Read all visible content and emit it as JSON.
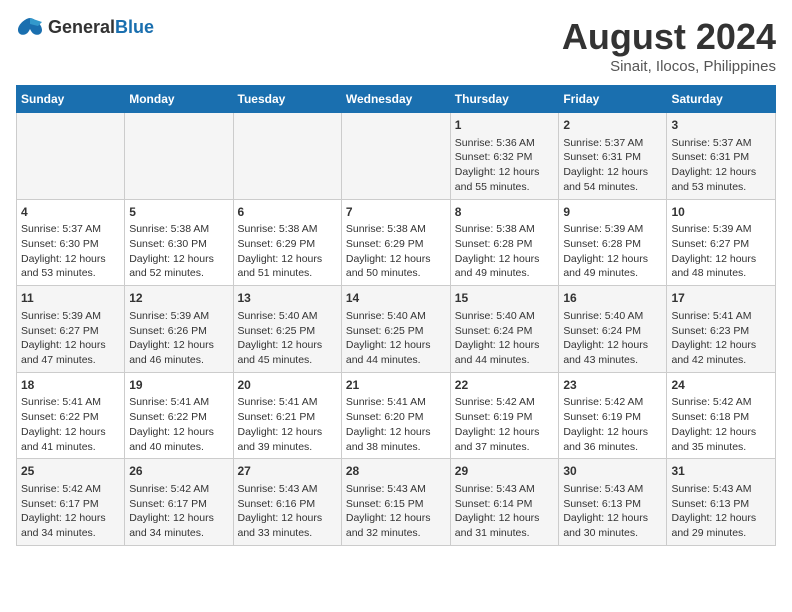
{
  "logo": {
    "general": "General",
    "blue": "Blue"
  },
  "title": "August 2024",
  "subtitle": "Sinait, Ilocos, Philippines",
  "days_of_week": [
    "Sunday",
    "Monday",
    "Tuesday",
    "Wednesday",
    "Thursday",
    "Friday",
    "Saturday"
  ],
  "weeks": [
    [
      {
        "day": "",
        "sunrise": "",
        "sunset": "",
        "daylight": ""
      },
      {
        "day": "",
        "sunrise": "",
        "sunset": "",
        "daylight": ""
      },
      {
        "day": "",
        "sunrise": "",
        "sunset": "",
        "daylight": ""
      },
      {
        "day": "",
        "sunrise": "",
        "sunset": "",
        "daylight": ""
      },
      {
        "day": "1",
        "sunrise": "Sunrise: 5:36 AM",
        "sunset": "Sunset: 6:32 PM",
        "daylight": "Daylight: 12 hours and 55 minutes."
      },
      {
        "day": "2",
        "sunrise": "Sunrise: 5:37 AM",
        "sunset": "Sunset: 6:31 PM",
        "daylight": "Daylight: 12 hours and 54 minutes."
      },
      {
        "day": "3",
        "sunrise": "Sunrise: 5:37 AM",
        "sunset": "Sunset: 6:31 PM",
        "daylight": "Daylight: 12 hours and 53 minutes."
      }
    ],
    [
      {
        "day": "4",
        "sunrise": "Sunrise: 5:37 AM",
        "sunset": "Sunset: 6:30 PM",
        "daylight": "Daylight: 12 hours and 53 minutes."
      },
      {
        "day": "5",
        "sunrise": "Sunrise: 5:38 AM",
        "sunset": "Sunset: 6:30 PM",
        "daylight": "Daylight: 12 hours and 52 minutes."
      },
      {
        "day": "6",
        "sunrise": "Sunrise: 5:38 AM",
        "sunset": "Sunset: 6:29 PM",
        "daylight": "Daylight: 12 hours and 51 minutes."
      },
      {
        "day": "7",
        "sunrise": "Sunrise: 5:38 AM",
        "sunset": "Sunset: 6:29 PM",
        "daylight": "Daylight: 12 hours and 50 minutes."
      },
      {
        "day": "8",
        "sunrise": "Sunrise: 5:38 AM",
        "sunset": "Sunset: 6:28 PM",
        "daylight": "Daylight: 12 hours and 49 minutes."
      },
      {
        "day": "9",
        "sunrise": "Sunrise: 5:39 AM",
        "sunset": "Sunset: 6:28 PM",
        "daylight": "Daylight: 12 hours and 49 minutes."
      },
      {
        "day": "10",
        "sunrise": "Sunrise: 5:39 AM",
        "sunset": "Sunset: 6:27 PM",
        "daylight": "Daylight: 12 hours and 48 minutes."
      }
    ],
    [
      {
        "day": "11",
        "sunrise": "Sunrise: 5:39 AM",
        "sunset": "Sunset: 6:27 PM",
        "daylight": "Daylight: 12 hours and 47 minutes."
      },
      {
        "day": "12",
        "sunrise": "Sunrise: 5:39 AM",
        "sunset": "Sunset: 6:26 PM",
        "daylight": "Daylight: 12 hours and 46 minutes."
      },
      {
        "day": "13",
        "sunrise": "Sunrise: 5:40 AM",
        "sunset": "Sunset: 6:25 PM",
        "daylight": "Daylight: 12 hours and 45 minutes."
      },
      {
        "day": "14",
        "sunrise": "Sunrise: 5:40 AM",
        "sunset": "Sunset: 6:25 PM",
        "daylight": "Daylight: 12 hours and 44 minutes."
      },
      {
        "day": "15",
        "sunrise": "Sunrise: 5:40 AM",
        "sunset": "Sunset: 6:24 PM",
        "daylight": "Daylight: 12 hours and 44 minutes."
      },
      {
        "day": "16",
        "sunrise": "Sunrise: 5:40 AM",
        "sunset": "Sunset: 6:24 PM",
        "daylight": "Daylight: 12 hours and 43 minutes."
      },
      {
        "day": "17",
        "sunrise": "Sunrise: 5:41 AM",
        "sunset": "Sunset: 6:23 PM",
        "daylight": "Daylight: 12 hours and 42 minutes."
      }
    ],
    [
      {
        "day": "18",
        "sunrise": "Sunrise: 5:41 AM",
        "sunset": "Sunset: 6:22 PM",
        "daylight": "Daylight: 12 hours and 41 minutes."
      },
      {
        "day": "19",
        "sunrise": "Sunrise: 5:41 AM",
        "sunset": "Sunset: 6:22 PM",
        "daylight": "Daylight: 12 hours and 40 minutes."
      },
      {
        "day": "20",
        "sunrise": "Sunrise: 5:41 AM",
        "sunset": "Sunset: 6:21 PM",
        "daylight": "Daylight: 12 hours and 39 minutes."
      },
      {
        "day": "21",
        "sunrise": "Sunrise: 5:41 AM",
        "sunset": "Sunset: 6:20 PM",
        "daylight": "Daylight: 12 hours and 38 minutes."
      },
      {
        "day": "22",
        "sunrise": "Sunrise: 5:42 AM",
        "sunset": "Sunset: 6:19 PM",
        "daylight": "Daylight: 12 hours and 37 minutes."
      },
      {
        "day": "23",
        "sunrise": "Sunrise: 5:42 AM",
        "sunset": "Sunset: 6:19 PM",
        "daylight": "Daylight: 12 hours and 36 minutes."
      },
      {
        "day": "24",
        "sunrise": "Sunrise: 5:42 AM",
        "sunset": "Sunset: 6:18 PM",
        "daylight": "Daylight: 12 hours and 35 minutes."
      }
    ],
    [
      {
        "day": "25",
        "sunrise": "Sunrise: 5:42 AM",
        "sunset": "Sunset: 6:17 PM",
        "daylight": "Daylight: 12 hours and 34 minutes."
      },
      {
        "day": "26",
        "sunrise": "Sunrise: 5:42 AM",
        "sunset": "Sunset: 6:17 PM",
        "daylight": "Daylight: 12 hours and 34 minutes."
      },
      {
        "day": "27",
        "sunrise": "Sunrise: 5:43 AM",
        "sunset": "Sunset: 6:16 PM",
        "daylight": "Daylight: 12 hours and 33 minutes."
      },
      {
        "day": "28",
        "sunrise": "Sunrise: 5:43 AM",
        "sunset": "Sunset: 6:15 PM",
        "daylight": "Daylight: 12 hours and 32 minutes."
      },
      {
        "day": "29",
        "sunrise": "Sunrise: 5:43 AM",
        "sunset": "Sunset: 6:14 PM",
        "daylight": "Daylight: 12 hours and 31 minutes."
      },
      {
        "day": "30",
        "sunrise": "Sunrise: 5:43 AM",
        "sunset": "Sunset: 6:13 PM",
        "daylight": "Daylight: 12 hours and 30 minutes."
      },
      {
        "day": "31",
        "sunrise": "Sunrise: 5:43 AM",
        "sunset": "Sunset: 6:13 PM",
        "daylight": "Daylight: 12 hours and 29 minutes."
      }
    ]
  ]
}
